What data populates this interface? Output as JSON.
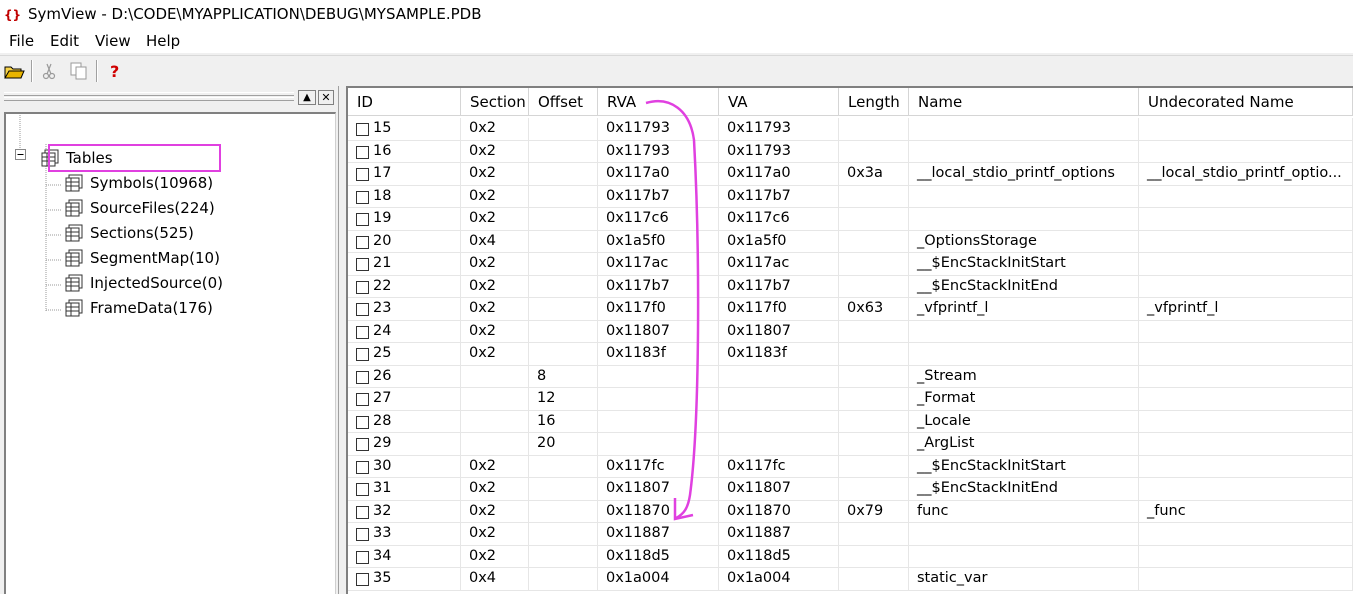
{
  "window": {
    "title": "SymView  - D:\\CODE\\MYAPPLICATION\\DEBUG\\MYSAMPLE.PDB"
  },
  "menu": [
    "File",
    "Edit",
    "View",
    "Help"
  ],
  "toolbar": {
    "icons": [
      "open-folder-icon",
      "cut-icon",
      "copy-icon",
      "help-icon"
    ]
  },
  "tree": {
    "root": "Tables",
    "items": [
      "Symbols(10968)",
      "SourceFiles(224)",
      "Sections(525)",
      "SegmentMap(10)",
      "InjectedSource(0)",
      "FrameData(176)"
    ],
    "selected_index": 0
  },
  "table": {
    "columns": [
      "ID",
      "Section",
      "Offset",
      "RVA",
      "VA",
      "Length",
      "Name",
      "Undecorated Name"
    ],
    "rows": [
      [
        "15",
        "0x2",
        "",
        "0x11793",
        "0x11793",
        "",
        "",
        ""
      ],
      [
        "16",
        "0x2",
        "",
        "0x11793",
        "0x11793",
        "",
        "",
        ""
      ],
      [
        "17",
        "0x2",
        "",
        "0x117a0",
        "0x117a0",
        "0x3a",
        "__local_stdio_printf_options",
        "__local_stdio_printf_optio..."
      ],
      [
        "18",
        "0x2",
        "",
        "0x117b7",
        "0x117b7",
        "",
        "",
        ""
      ],
      [
        "19",
        "0x2",
        "",
        "0x117c6",
        "0x117c6",
        "",
        "",
        ""
      ],
      [
        "20",
        "0x4",
        "",
        "0x1a5f0",
        "0x1a5f0",
        "",
        "_OptionsStorage",
        ""
      ],
      [
        "21",
        "0x2",
        "",
        "0x117ac",
        "0x117ac",
        "",
        "__$EncStackInitStart",
        ""
      ],
      [
        "22",
        "0x2",
        "",
        "0x117b7",
        "0x117b7",
        "",
        "__$EncStackInitEnd",
        ""
      ],
      [
        "23",
        "0x2",
        "",
        "0x117f0",
        "0x117f0",
        "0x63",
        "_vfprintf_l",
        "_vfprintf_l"
      ],
      [
        "24",
        "0x2",
        "",
        "0x11807",
        "0x11807",
        "",
        "",
        ""
      ],
      [
        "25",
        "0x2",
        "",
        "0x1183f",
        "0x1183f",
        "",
        "",
        ""
      ],
      [
        "26",
        "",
        "8",
        "",
        "",
        "",
        "_Stream",
        ""
      ],
      [
        "27",
        "",
        "12",
        "",
        "",
        "",
        "_Format",
        ""
      ],
      [
        "28",
        "",
        "16",
        "",
        "",
        "",
        "_Locale",
        ""
      ],
      [
        "29",
        "",
        "20",
        "",
        "",
        "",
        "_ArgList",
        ""
      ],
      [
        "30",
        "0x2",
        "",
        "0x117fc",
        "0x117fc",
        "",
        "__$EncStackInitStart",
        ""
      ],
      [
        "31",
        "0x2",
        "",
        "0x11807",
        "0x11807",
        "",
        "__$EncStackInitEnd",
        ""
      ],
      [
        "32",
        "0x2",
        "",
        "0x11870",
        "0x11870",
        "0x79",
        "func",
        "_func"
      ],
      [
        "33",
        "0x2",
        "",
        "0x11887",
        "0x11887",
        "",
        "",
        ""
      ],
      [
        "34",
        "0x2",
        "",
        "0x118d5",
        "0x118d5",
        "",
        "",
        ""
      ],
      [
        "35",
        "0x4",
        "",
        "0x1a004",
        "0x1a004",
        "",
        "static_var",
        ""
      ]
    ]
  },
  "colors": {
    "highlight": "#e040e0",
    "grid": "#e6e6e6",
    "header_border": "#d5d5d5"
  }
}
